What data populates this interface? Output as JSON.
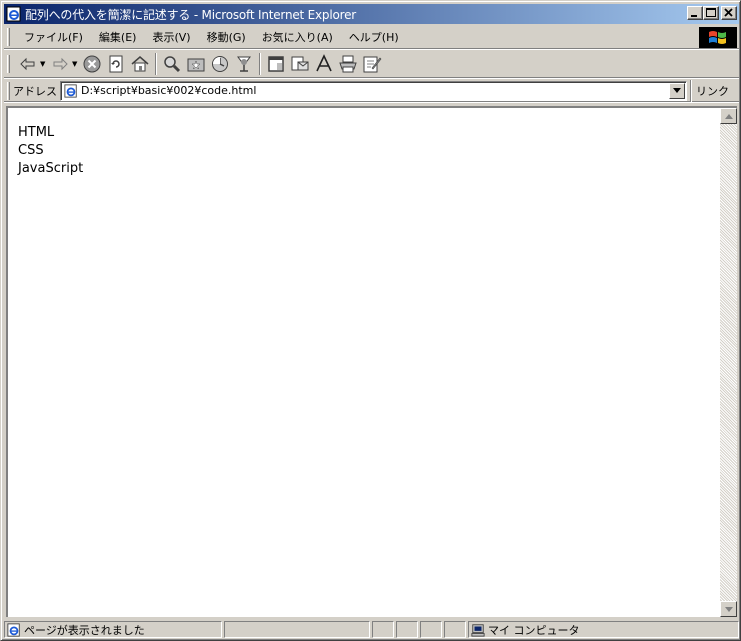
{
  "window": {
    "title": "配列への代入を簡潔に記述する - Microsoft Internet Explorer",
    "buttons": {
      "minimize": "_",
      "maximize": "□",
      "close": "×"
    }
  },
  "menu": {
    "items": [
      "ファイル(F)",
      "編集(E)",
      "表示(V)",
      "移動(G)",
      "お気に入り(A)",
      "ヘルプ(H)"
    ]
  },
  "toolbar": {
    "buttons": [
      "back-icon",
      "forward-icon",
      "stop-icon",
      "refresh-icon",
      "home-icon",
      "search-icon",
      "favorites-icon",
      "history-icon",
      "channels-icon",
      "fullscreen-icon",
      "mail-icon",
      "font-icon",
      "print-icon",
      "edit-icon"
    ]
  },
  "address": {
    "label": "アドレス",
    "url": "D:¥script¥basic¥002¥code.html",
    "links_label": "リンク"
  },
  "content": {
    "lines": [
      "HTML",
      "CSS",
      "JavaScript"
    ]
  },
  "status": {
    "text": "ページが表示されました",
    "zone": "マイ コンピュータ"
  },
  "colors": {
    "title_start": "#0a246a",
    "title_end": "#a6caf0",
    "face": "#d4d0c8"
  }
}
